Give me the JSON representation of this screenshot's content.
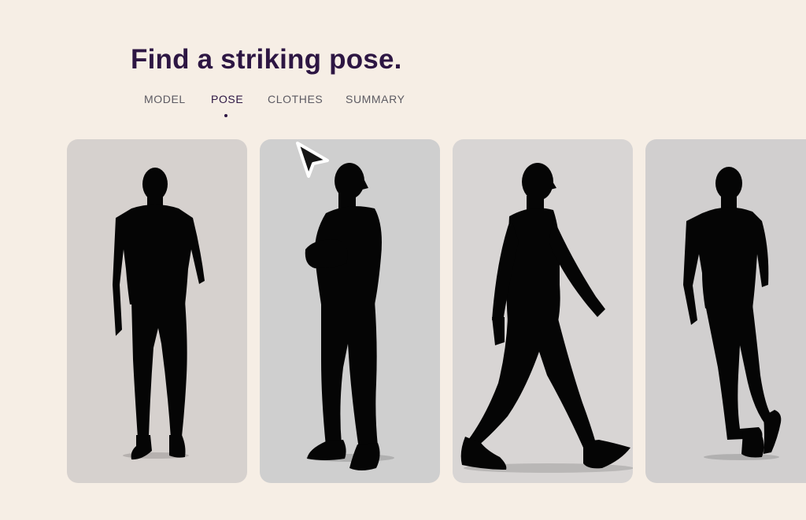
{
  "page": {
    "title": "Find a striking pose."
  },
  "tabs": [
    {
      "label": "MODEL",
      "active": false
    },
    {
      "label": "POSE",
      "active": true
    },
    {
      "label": "CLOTHES",
      "active": false
    },
    {
      "label": "SUMMARY",
      "active": false
    }
  ],
  "poses": [
    {
      "name": "standing-hands-in-pockets",
      "background": "#d6d1ce"
    },
    {
      "name": "arms-crossed-profile",
      "background": "#cfcfcf"
    },
    {
      "name": "walking-stride",
      "background": "#d8d5d4"
    },
    {
      "name": "crossed-legs-standing",
      "background": "#d1cfcf"
    }
  ],
  "colors": {
    "background": "#f6eee5",
    "title": "#2d1643",
    "tab_inactive": "#5c5a62",
    "tab_active": "#2d1643",
    "silhouette": "#050505"
  },
  "cursor": {
    "icon": "pointer-arrow-icon"
  }
}
